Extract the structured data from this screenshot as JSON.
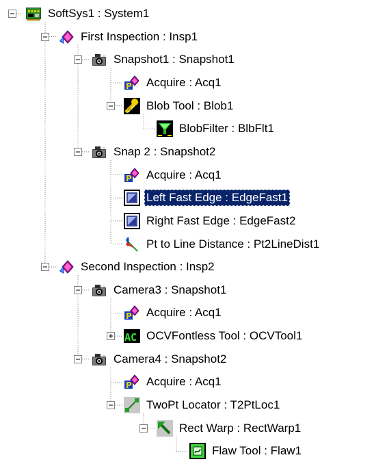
{
  "tree": {
    "selection_color": "#0a246a",
    "nodes": [
      {
        "label": "SoftSys1 : System1",
        "depth": 0,
        "icon": "system-board-icon",
        "expander": "collapse",
        "selected": false
      },
      {
        "label": "First Inspection : Insp1",
        "depth": 1,
        "icon": "inspection-icon",
        "expander": "collapse",
        "selected": false
      },
      {
        "label": "Snapshot1 : Snapshot1",
        "depth": 2,
        "icon": "camera-icon",
        "expander": "collapse",
        "selected": false
      },
      {
        "label": "Acquire : Acq1",
        "depth": 3,
        "icon": "acquire-icon",
        "expander": "none",
        "selected": false
      },
      {
        "label": "Blob Tool : Blob1",
        "depth": 3,
        "icon": "blob-tool-icon",
        "expander": "collapse",
        "selected": false
      },
      {
        "label": "BlobFilter : BlbFlt1",
        "depth": 4,
        "icon": "blob-filter-icon",
        "expander": "none",
        "selected": false
      },
      {
        "label": "Snap 2 : Snapshot2",
        "depth": 2,
        "icon": "camera-icon",
        "expander": "collapse",
        "selected": false
      },
      {
        "label": "Acquire : Acq1",
        "depth": 3,
        "icon": "acquire-icon",
        "expander": "none",
        "selected": false
      },
      {
        "label": "Left Fast Edge : EdgeFast1",
        "depth": 3,
        "icon": "fast-edge-icon",
        "expander": "none",
        "selected": true
      },
      {
        "label": "Right Fast Edge : EdgeFast2",
        "depth": 3,
        "icon": "fast-edge-icon",
        "expander": "none",
        "selected": false
      },
      {
        "label": "Pt to Line Distance : Pt2LineDist1",
        "depth": 3,
        "icon": "point-line-distance-icon",
        "expander": "none",
        "selected": false
      },
      {
        "label": "Second Inspection : Insp2",
        "depth": 1,
        "icon": "inspection-icon",
        "expander": "collapse",
        "selected": false
      },
      {
        "label": "Camera3 : Snapshot1",
        "depth": 2,
        "icon": "camera-icon",
        "expander": "collapse",
        "selected": false
      },
      {
        "label": "Acquire : Acq1",
        "depth": 3,
        "icon": "acquire-icon",
        "expander": "none",
        "selected": false
      },
      {
        "label": "OCVFontless Tool : OCVTool1",
        "depth": 3,
        "icon": "ocv-tool-icon",
        "expander": "expand",
        "selected": false
      },
      {
        "label": "Camera4 : Snapshot2",
        "depth": 2,
        "icon": "camera-icon",
        "expander": "collapse",
        "selected": false
      },
      {
        "label": "Acquire : Acq1",
        "depth": 3,
        "icon": "acquire-icon",
        "expander": "none",
        "selected": false
      },
      {
        "label": "TwoPt Locator : T2PtLoc1",
        "depth": 3,
        "icon": "two-point-locator-icon",
        "expander": "collapse",
        "selected": false
      },
      {
        "label": "Rect Warp : RectWarp1",
        "depth": 4,
        "icon": "rect-warp-icon",
        "expander": "collapse",
        "selected": false
      },
      {
        "label": "Flaw Tool : Flaw1",
        "depth": 5,
        "icon": "flaw-tool-icon",
        "expander": "none",
        "selected": false
      }
    ]
  }
}
